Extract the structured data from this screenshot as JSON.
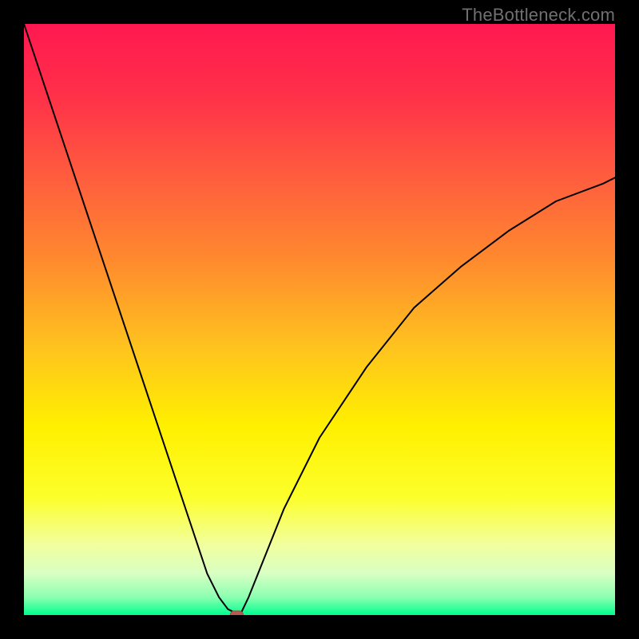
{
  "watermark": "TheBottleneck.com",
  "chart_data": {
    "type": "line",
    "title": "",
    "xlabel": "",
    "ylabel": "",
    "xlim": [
      0,
      100
    ],
    "ylim": [
      0,
      100
    ],
    "grid": false,
    "legend": false,
    "background": {
      "type": "vertical-gradient",
      "stops": [
        {
          "pos": 0.0,
          "color": "#ff1850"
        },
        {
          "pos": 0.12,
          "color": "#ff3049"
        },
        {
          "pos": 0.25,
          "color": "#ff5a3f"
        },
        {
          "pos": 0.4,
          "color": "#ff8a2e"
        },
        {
          "pos": 0.55,
          "color": "#ffc41e"
        },
        {
          "pos": 0.68,
          "color": "#fff000"
        },
        {
          "pos": 0.8,
          "color": "#fcff2a"
        },
        {
          "pos": 0.88,
          "color": "#f2ff9d"
        },
        {
          "pos": 0.93,
          "color": "#d8ffc3"
        },
        {
          "pos": 0.97,
          "color": "#8bffb1"
        },
        {
          "pos": 1.0,
          "color": "#00ff8e"
        }
      ]
    },
    "series": [
      {
        "name": "bottleneck-curve",
        "type": "line",
        "color": "#000000",
        "stroke_width": 2,
        "x": [
          0,
          4,
          8,
          12,
          16,
          20,
          24,
          28,
          31,
          33,
          34.5,
          35.5,
          36,
          36.8,
          38,
          40,
          44,
          50,
          58,
          66,
          74,
          82,
          90,
          98,
          100
        ],
        "y": [
          100,
          88,
          76,
          64,
          52,
          40,
          28,
          16,
          7,
          3,
          1,
          0.5,
          0,
          0.5,
          3,
          8,
          18,
          30,
          42,
          52,
          59,
          65,
          70,
          73,
          74
        ]
      }
    ],
    "markers": [
      {
        "name": "minimum-marker",
        "shape": "rounded-rect",
        "x": 36,
        "y": 0,
        "width": 2.2,
        "height": 1.4,
        "fill": "#b85a52",
        "stroke": "#a04a44"
      }
    ]
  }
}
